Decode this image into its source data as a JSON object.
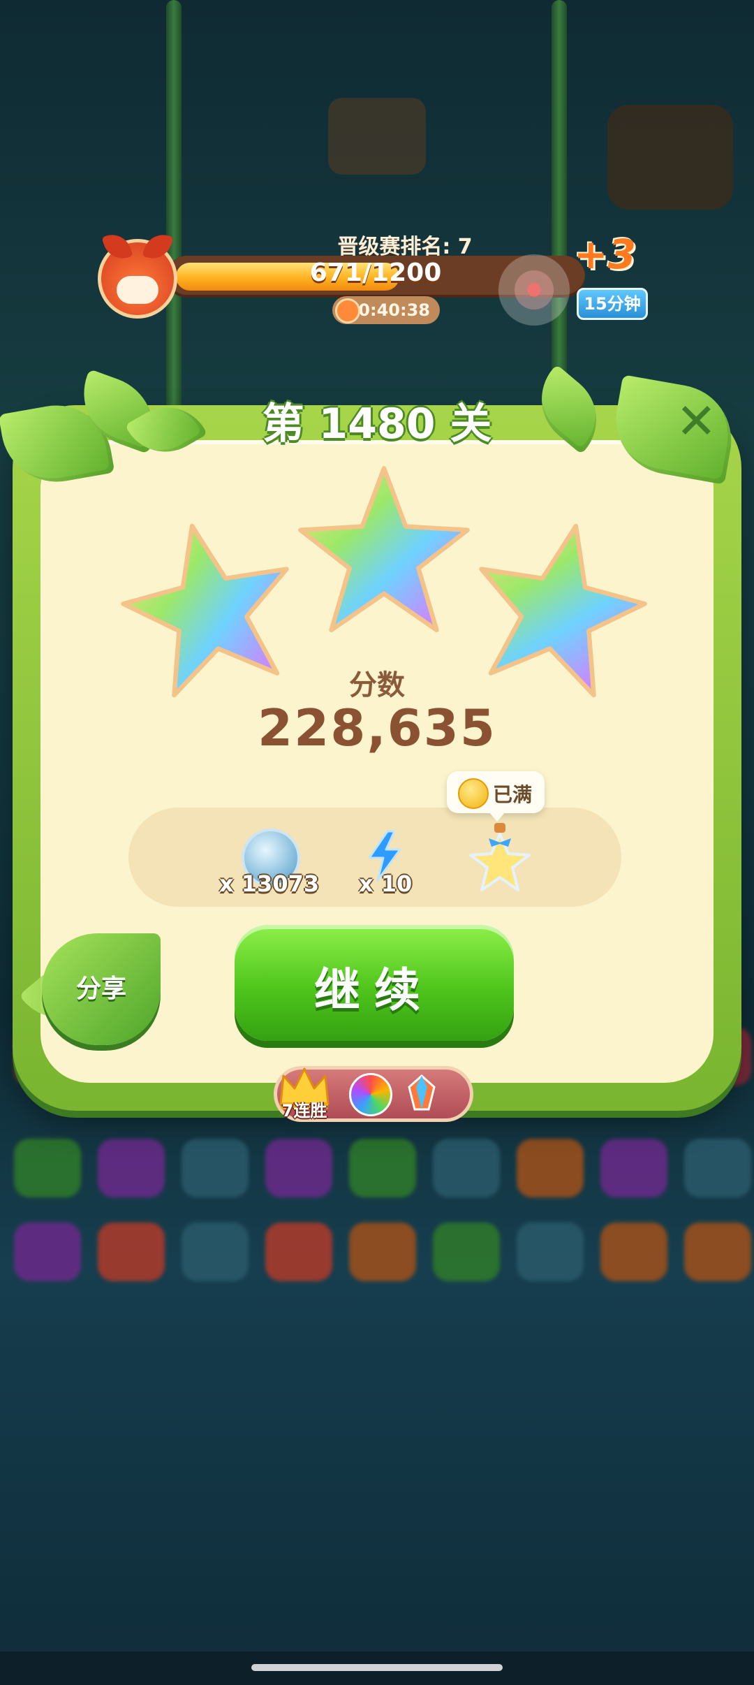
{
  "rank": {
    "label": "晋级赛排名: 7",
    "progress_text": "671/1200",
    "progress_current": 671,
    "progress_max": 1200,
    "timer": "80:40:38",
    "bonus": "+3",
    "bonus_duration": "15分钟"
  },
  "dialog": {
    "level_title": "第 1480 关",
    "stars_earned": 3,
    "stars_total": 3,
    "score_label": "分数",
    "score_value": "228,635"
  },
  "rewards": {
    "coin_count": "x 13073",
    "lightning_count": "x 10",
    "full_label": "已满"
  },
  "actions": {
    "share_label": "分享",
    "continue_label": "继续"
  },
  "streak": {
    "label": "7连胜"
  },
  "icons": [
    "fox-avatar-icon",
    "clock-icon",
    "close-icon",
    "star-icon",
    "leaf-coin-icon",
    "lightning-icon",
    "star-bottle-icon",
    "gold-coin-icon",
    "crown-icon",
    "rainbow-booster-icon",
    "crystal-booster-icon"
  ],
  "colors": {
    "panel_green": "#79b530",
    "panel_cream": "#fcf4cc",
    "button_green": "#4ec51c",
    "bar_orange": "#ffb21f",
    "score_brown": "#8a5233"
  }
}
